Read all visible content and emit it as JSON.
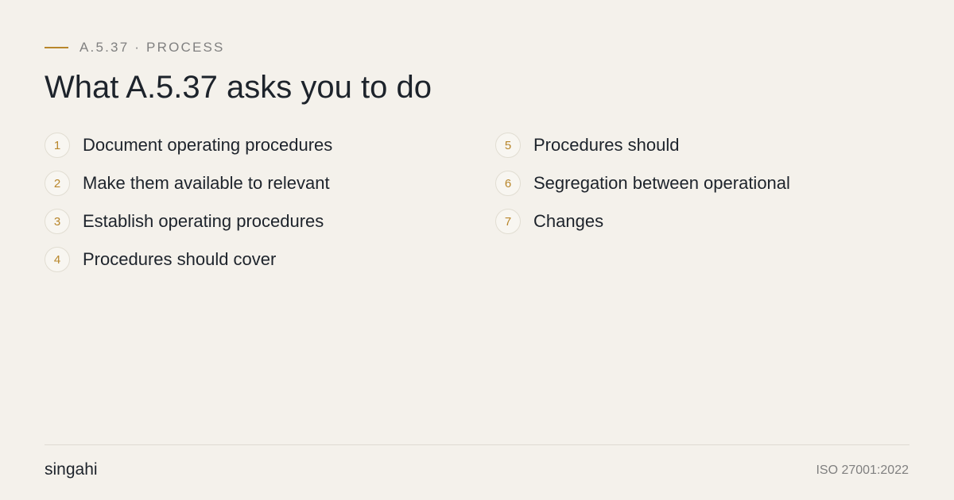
{
  "header": {
    "eyebrow": "A.5.37 · PROCESS",
    "title": "What A.5.37 asks you to do"
  },
  "steps": [
    {
      "number": "1",
      "label": "Document operating procedures"
    },
    {
      "number": "2",
      "label": "Make them available to relevant"
    },
    {
      "number": "3",
      "label": "Establish operating procedures"
    },
    {
      "number": "4",
      "label": "Procedures should cover"
    },
    {
      "number": "5",
      "label": "Procedures should"
    },
    {
      "number": "6",
      "label": "Segregation between operational"
    },
    {
      "number": "7",
      "label": "Changes"
    }
  ],
  "footer": {
    "brand": "singahi",
    "standard": "ISO 27001:2022"
  },
  "colors": {
    "accent": "#b8862b",
    "background": "#f4f1eb",
    "text": "#1d232b",
    "muted": "#808080"
  }
}
